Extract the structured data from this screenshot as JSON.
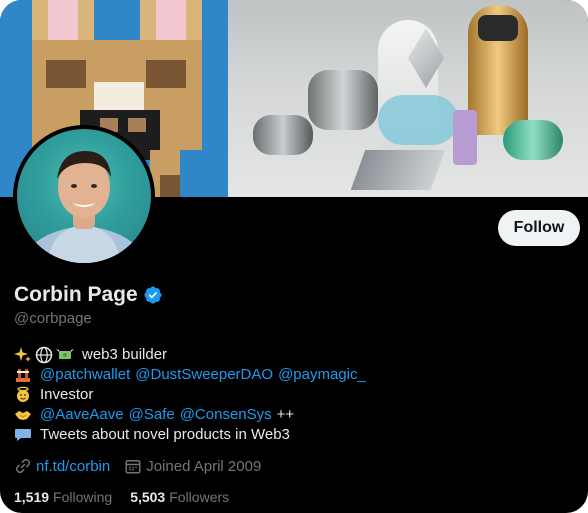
{
  "profile": {
    "name": "Corbin Page",
    "handle": "@corbpage",
    "follow_label": "Follow",
    "bio": {
      "line1_text": "web3 builder",
      "line2_links": [
        "@patchwallet",
        "@DustSweeperDAO",
        "@paymagic_"
      ],
      "line3_text": "Investor",
      "line4_links": [
        "@AaveAave",
        "@Safe",
        "@ConsenSys"
      ],
      "line4_suffix": "++",
      "line5_text": "Tweets about novel products in Web3"
    },
    "website": "nf.td/corbin",
    "joined": "Joined April 2009",
    "following_count": "1,519",
    "following_label": "Following",
    "followers_count": "5,503",
    "followers_label": "Followers"
  },
  "icons": {
    "verified": "verified-badge-icon",
    "link": "link-icon",
    "calendar": "calendar-icon"
  },
  "colors": {
    "background": "#000000",
    "link": "#1d9bf0",
    "verified": "#1d9bf0",
    "muted": "#71767b",
    "follow_button_bg": "#eff3f4"
  }
}
